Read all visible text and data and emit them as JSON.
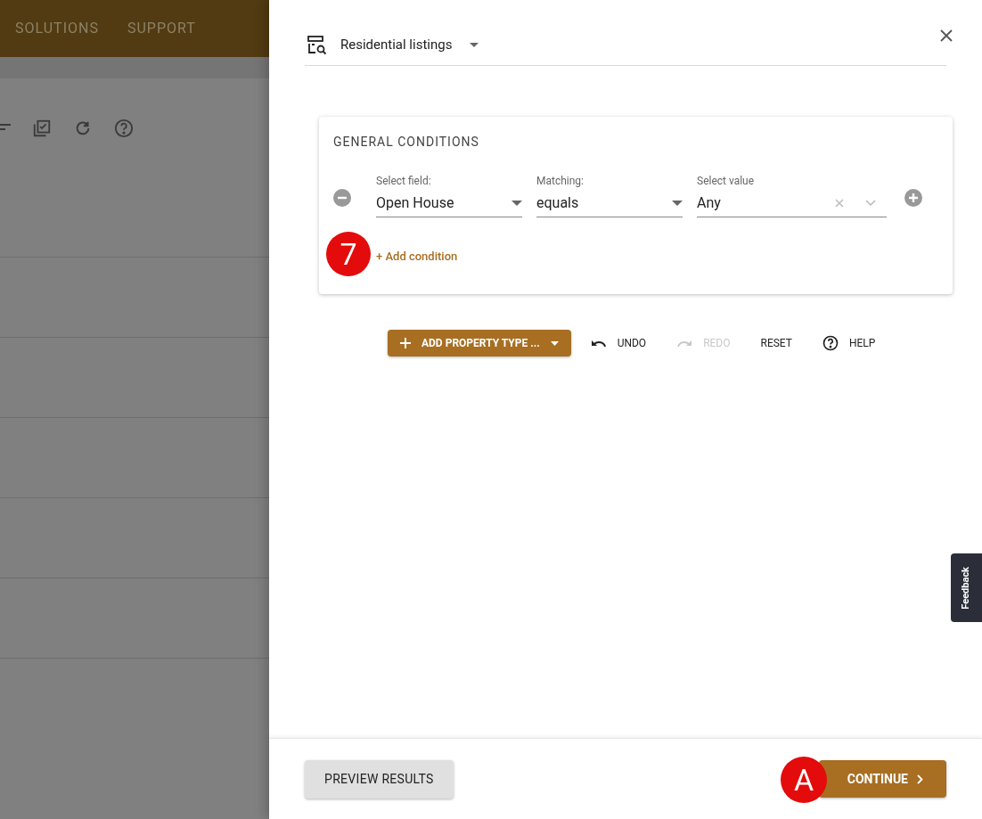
{
  "background_nav": [
    "SOLUTIONS",
    "SUPPORT"
  ],
  "panel": {
    "title": "Residential listings",
    "section_title": "GENERAL CONDITIONS",
    "conditions": [
      {
        "field_label": "Select field:",
        "field_value": "Open House",
        "matching_label": "Matching:",
        "matching_value": "equals",
        "value_label": "Select value",
        "value": "Any"
      }
    ],
    "add_condition": "+ Add condition",
    "marker_add": "7",
    "toolbar": [
      {
        "kind": "add",
        "label": "ADD PROPERTY TYPE ...",
        "disabled": false
      },
      {
        "kind": "undo",
        "label": "UNDO",
        "disabled": false
      },
      {
        "kind": "redo",
        "label": "REDO",
        "disabled": true
      },
      {
        "kind": "reset",
        "label": "RESET",
        "disabled": false
      },
      {
        "kind": "help",
        "label": "HELP",
        "disabled": false
      }
    ],
    "preview_button": "PREVIEW RESULTS",
    "continue_button": "CONTINUE",
    "marker_continue": "A"
  },
  "feedback": "Feedback"
}
